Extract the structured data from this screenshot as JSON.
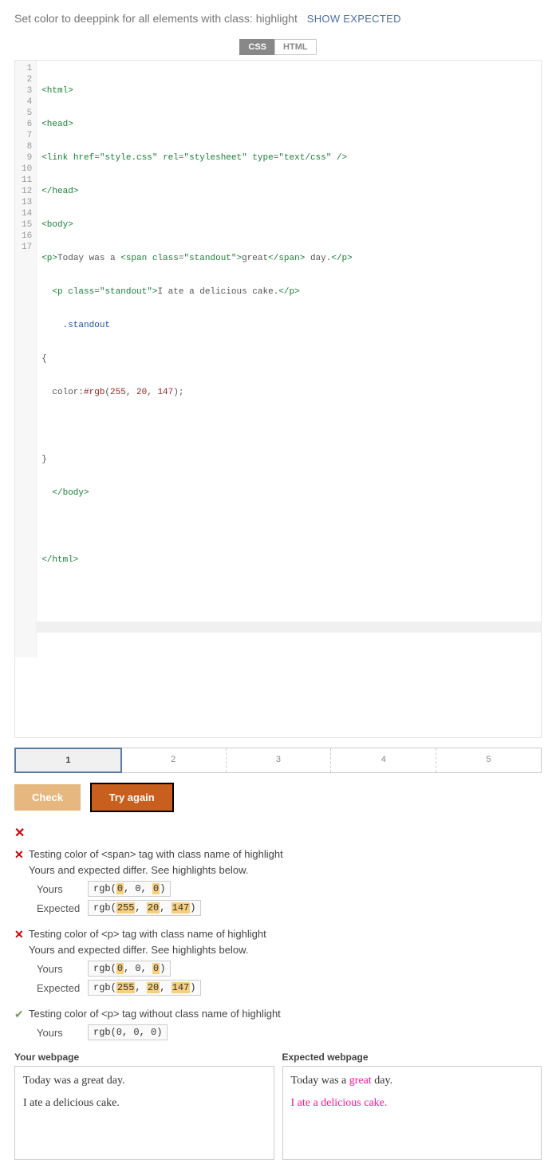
{
  "instruction": "Set color to deeppink for all elements with class: highlight",
  "show_expected": "SHOW EXPECTED",
  "lang_tabs": {
    "css": "CSS",
    "html": "HTML"
  },
  "code_lines": [
    "<html>",
    "<head>",
    "<link href=\"style.css\" rel=\"stylesheet\" type=\"text/css\" />",
    "</head>",
    "<body>",
    "<p>Today was a <span class=\"standout\">great</span> day.</p>",
    "  <p class=\"standout\">I ate a delicious cake.</p>",
    "    .standout",
    "{",
    "  color:#rgb(255, 20, 147);",
    "",
    "}",
    "  </body>",
    "",
    "</html>",
    "",
    ""
  ],
  "pagination": [
    "1",
    "2",
    "3",
    "4",
    "5"
  ],
  "buttons": {
    "check": "Check",
    "try_again": "Try again"
  },
  "fail_mark": "✕",
  "tests": [
    {
      "status": "fail",
      "title": "Testing color of <span> tag with class name of highlight",
      "sub": "Yours and expected differ. See highlights below.",
      "yours_label": "Yours",
      "yours_pre": "rgb(",
      "yours_a": "0",
      "yours_mid1": ", 0, ",
      "yours_c": "0",
      "yours_post": ")",
      "exp_label": "Expected",
      "exp_pre": "rgb(",
      "exp_a": "255",
      "exp_mid1": ", ",
      "exp_b": "20",
      "exp_mid2": ", ",
      "exp_c": "147",
      "exp_post": ")"
    },
    {
      "status": "fail",
      "title": "Testing color of <p> tag with class name of highlight",
      "sub": "Yours and expected differ. See highlights below.",
      "yours_label": "Yours",
      "yours_pre": "rgb(",
      "yours_a": "0",
      "yours_mid1": ", 0, ",
      "yours_c": "0",
      "yours_post": ")",
      "exp_label": "Expected",
      "exp_pre": "rgb(",
      "exp_a": "255",
      "exp_mid1": ", ",
      "exp_b": "20",
      "exp_mid2": ", ",
      "exp_c": "147",
      "exp_post": ")"
    }
  ],
  "pass_test": {
    "title": "Testing color of <p> tag without class name of highlight",
    "yours_label": "Yours",
    "yours_val": "rgb(0, 0, 0)"
  },
  "preview": {
    "your_title": "Your webpage",
    "expected_title": "Expected webpage",
    "line1_a": "Today was a ",
    "line1_b": "great",
    "line1_c": " day.",
    "line2": "I ate a delicious cake."
  }
}
